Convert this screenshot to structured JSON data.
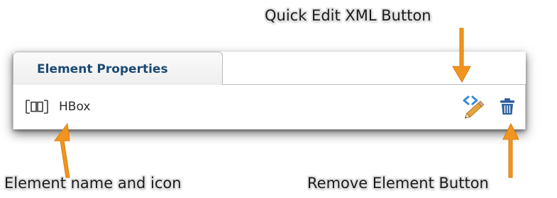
{
  "callouts": {
    "quick_edit": "Quick Edit XML Button",
    "element_name": "Element name and icon",
    "remove": "Remove Element Button"
  },
  "panel": {
    "tab_title": "Element Properties",
    "element": {
      "name": "HBox",
      "icon": "hbox-icon"
    },
    "actions": {
      "quick_edit_icon": "xml-pencil-icon",
      "remove_icon": "trash-icon"
    }
  },
  "colors": {
    "tab_title": "#1b4a72",
    "arrow": "#f2951e",
    "xml_icon": "#3b8ad6",
    "trash_icon": "#2c5f9e",
    "pencil": "#e8a33c"
  }
}
